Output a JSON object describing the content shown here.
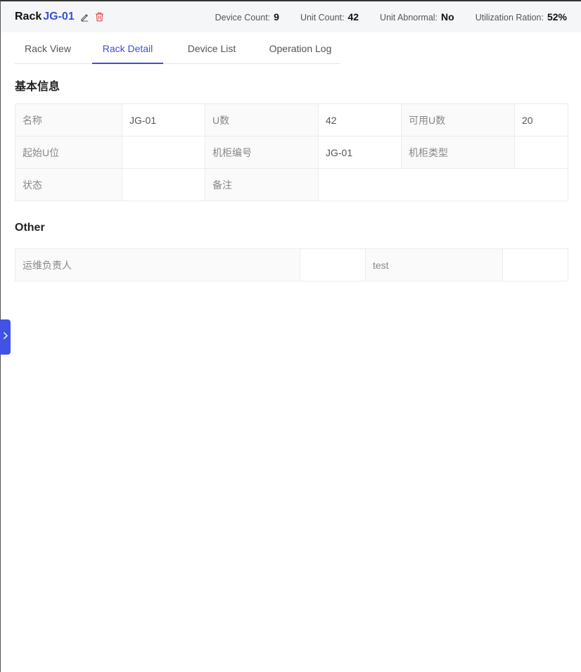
{
  "header": {
    "title_prefix": "Rack",
    "rack_id": "JG-01",
    "stats": [
      {
        "label": "Device Count:",
        "value": "9"
      },
      {
        "label": "Unit Count:",
        "value": "42"
      },
      {
        "label": "Unit Abnormal:",
        "value": "No"
      },
      {
        "label": "Utilization Ration:",
        "value": "52%"
      }
    ]
  },
  "tabs": [
    {
      "label": "Rack View"
    },
    {
      "label": "Rack Detail",
      "active": true
    },
    {
      "label": "Device List"
    },
    {
      "label": "Operation Log"
    }
  ],
  "basic": {
    "title": "基本信息",
    "rows": [
      [
        {
          "label": "名称",
          "value": "JG-01"
        },
        {
          "label": "U数",
          "value": "42"
        },
        {
          "label": "可用U数",
          "value": "20"
        }
      ],
      [
        {
          "label": "起始U位",
          "value": ""
        },
        {
          "label": "机柜编号",
          "value": "JG-01"
        },
        {
          "label": "机柜类型",
          "value": ""
        }
      ],
      [
        {
          "label": "状态",
          "value": ""
        },
        {
          "label": "备注",
          "value": ""
        }
      ]
    ]
  },
  "other": {
    "title": "Other",
    "fields": [
      {
        "label": "运维负责人",
        "value": ""
      },
      {
        "label": "test",
        "value": ""
      }
    ]
  },
  "icons": {
    "edit": "pencil-icon",
    "delete": "trash-icon",
    "toggle": "chevron-right-icon"
  },
  "colors": {
    "accent": "#3b4fd6",
    "delete": "#e5484d",
    "toggle_bg": "#4152e6"
  }
}
